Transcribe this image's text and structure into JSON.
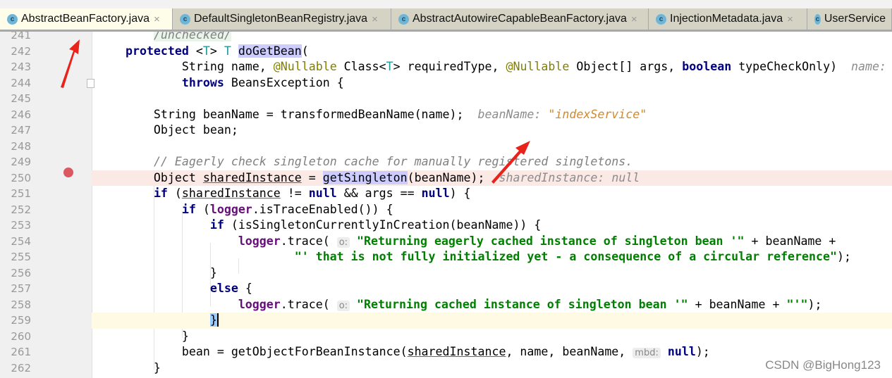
{
  "tabs": [
    {
      "label": "AbstractBeanFactory.java",
      "active": true,
      "closable": true
    },
    {
      "label": "DefaultSingletonBeanRegistry.java",
      "closable": true
    },
    {
      "label": "AbstractAutowireCapableBeanFactory.java",
      "closable": true
    },
    {
      "label": "InjectionMetadata.java",
      "closable": true
    },
    {
      "label": "UserService",
      "closable": false
    }
  ],
  "class_icon": "c",
  "close_glyph": "×",
  "watermark": "CSDN @BigHong123",
  "colors": {
    "keyword": "#000080",
    "string": "#008000",
    "breakpoint_line": "#fbe9e6",
    "caret_line": "#fffae3",
    "arrow": "#e8231b"
  },
  "code": {
    "lines": [
      {
        "n": "241",
        "segs": [
          [
            "        ",
            "p"
          ],
          [
            "/unchecked/",
            "c cm241"
          ]
        ]
      },
      {
        "n": "242",
        "segs": [
          [
            "    ",
            "p"
          ],
          [
            "protected",
            "k"
          ],
          [
            " <",
            "p"
          ],
          [
            "T",
            "t"
          ],
          [
            "> ",
            "p"
          ],
          [
            "T",
            "t"
          ],
          [
            " ",
            "p"
          ],
          [
            "doGetBean",
            "m"
          ],
          [
            "(",
            "p"
          ]
        ]
      },
      {
        "n": "243",
        "segs": [
          [
            "            String name, ",
            "p"
          ],
          [
            "@Nullable",
            "a"
          ],
          [
            " Class<",
            "p"
          ],
          [
            "T",
            "t"
          ],
          [
            "> requiredType, ",
            "p"
          ],
          [
            "@Nullable",
            "a"
          ],
          [
            " Object[] args, ",
            "p"
          ],
          [
            "boolean",
            "k"
          ],
          [
            " typeCheckOnly)  ",
            "p"
          ],
          [
            "name:",
            "h"
          ]
        ]
      },
      {
        "n": "244",
        "segs": [
          [
            "            ",
            "p"
          ],
          [
            "throws",
            "k"
          ],
          [
            " BeansException {",
            "p"
          ]
        ]
      },
      {
        "n": "245",
        "segs": []
      },
      {
        "n": "246",
        "segs": [
          [
            "        String beanName = transformedBeanName(name);  ",
            "p"
          ],
          [
            "beanName: ",
            "h"
          ],
          [
            "\"indexService\"",
            "hv"
          ]
        ]
      },
      {
        "n": "247",
        "segs": [
          [
            "        Object bean;",
            "p"
          ]
        ]
      },
      {
        "n": "248",
        "segs": []
      },
      {
        "n": "249",
        "segs": [
          [
            "        ",
            "p"
          ],
          [
            "// Eagerly check singleton cache for manually registered singletons.",
            "c"
          ]
        ]
      },
      {
        "n": "250",
        "segs": [
          [
            "        Object ",
            "p"
          ],
          [
            "sharedInstance",
            "u"
          ],
          [
            " = ",
            "p"
          ],
          [
            "getSingleton",
            "m"
          ],
          [
            "(beanName);  ",
            "p"
          ],
          [
            "sharedInstance: null",
            "h"
          ]
        ]
      },
      {
        "n": "251",
        "segs": [
          [
            "        ",
            "p"
          ],
          [
            "if",
            "k"
          ],
          [
            " (",
            "p"
          ],
          [
            "sharedInstance",
            "u"
          ],
          [
            " != ",
            "p"
          ],
          [
            "null",
            "k"
          ],
          [
            " && args == ",
            "p"
          ],
          [
            "null",
            "k"
          ],
          [
            ") {",
            "p"
          ]
        ]
      },
      {
        "n": "252",
        "segs": [
          [
            "            ",
            "p"
          ],
          [
            "if",
            "k"
          ],
          [
            " (",
            "p"
          ],
          [
            "logger",
            "f"
          ],
          [
            ".isTraceEnabled()) {",
            "p"
          ]
        ]
      },
      {
        "n": "253",
        "segs": [
          [
            "                ",
            "p"
          ],
          [
            "if",
            "k"
          ],
          [
            " (isSingletonCurrentlyInCreation(beanName)) {",
            "p"
          ]
        ]
      },
      {
        "n": "254",
        "segs": [
          [
            "                    ",
            "p"
          ],
          [
            "logger",
            "f"
          ],
          [
            ".trace( ",
            "p"
          ],
          [
            "o:",
            "pb"
          ],
          [
            " ",
            "p"
          ],
          [
            "\"Returning eagerly cached instance of singleton bean '\"",
            "s"
          ],
          [
            " + beanName +",
            "p"
          ]
        ]
      },
      {
        "n": "255",
        "segs": [
          [
            "                            ",
            "p"
          ],
          [
            "\"' that is not fully initialized yet - a consequence of a circular reference\"",
            "s"
          ],
          [
            ");",
            "p"
          ]
        ]
      },
      {
        "n": "256",
        "segs": [
          [
            "                }",
            "p"
          ]
        ]
      },
      {
        "n": "257",
        "segs": [
          [
            "                ",
            "p"
          ],
          [
            "else",
            "k"
          ],
          [
            " {",
            "p"
          ]
        ]
      },
      {
        "n": "258",
        "segs": [
          [
            "                    ",
            "p"
          ],
          [
            "logger",
            "f"
          ],
          [
            ".trace( ",
            "p"
          ],
          [
            "o:",
            "pb"
          ],
          [
            " ",
            "p"
          ],
          [
            "\"Returning cached instance of singleton bean '\"",
            "s"
          ],
          [
            " + beanName + ",
            "p"
          ],
          [
            "\"'\"",
            "s"
          ],
          [
            ");",
            "p"
          ]
        ]
      },
      {
        "n": "259",
        "segs": [
          [
            "                ",
            "p"
          ],
          [
            "}",
            "bh"
          ]
        ]
      },
      {
        "n": "260",
        "segs": [
          [
            "            }",
            "p"
          ]
        ]
      },
      {
        "n": "261",
        "segs": [
          [
            "            bean = getObjectForBeanInstance(",
            "p"
          ],
          [
            "sharedInstance",
            "u"
          ],
          [
            ", name, beanName, ",
            "p"
          ],
          [
            "mbd:",
            "pb"
          ],
          [
            " ",
            "p"
          ],
          [
            "null",
            "k"
          ],
          [
            ");",
            "p"
          ]
        ]
      },
      {
        "n": "262",
        "segs": [
          [
            "        }",
            "p"
          ]
        ]
      }
    ]
  }
}
